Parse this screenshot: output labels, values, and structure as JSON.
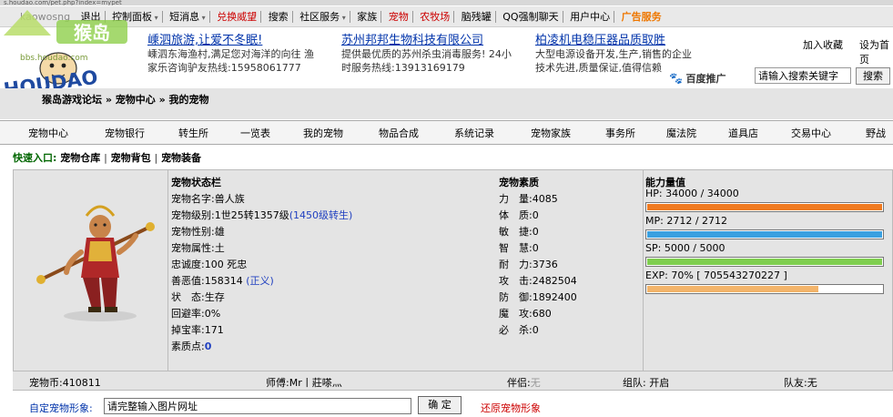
{
  "url_text": "s.houdao.com/pet.php?index=mypet",
  "logo": {
    "overlay": "kaowosng",
    "watermark": "bbs.houdao.com"
  },
  "topnav": [
    {
      "label": "退出",
      "style": ""
    },
    {
      "label": "控制面板",
      "style": "arrow"
    },
    {
      "label": "短消息",
      "style": "arrow"
    },
    {
      "label": "兑换威望",
      "style": "red"
    },
    {
      "label": "搜索",
      "style": ""
    },
    {
      "label": "社区服务",
      "style": "arrow"
    },
    {
      "label": "家族",
      "style": ""
    },
    {
      "label": "宠物",
      "style": "red"
    },
    {
      "label": "农牧场",
      "style": "red"
    },
    {
      "label": "脑残罐",
      "style": ""
    },
    {
      "label": "QQ强制聊天",
      "style": ""
    },
    {
      "label": "用户中心",
      "style": ""
    },
    {
      "label": "广告服务",
      "style": "orange"
    }
  ],
  "ads": [
    {
      "title": "嵊泗旅游,让爱不冬眠!",
      "desc1": "嵊泗东海渔村,满足您对海洋的向往 渔",
      "desc2": "家乐咨询驴友热线:15958061777"
    },
    {
      "title": "苏州邦邦生物科技有限公司",
      "desc1": "提供最优质的苏州杀虫消毒服务! 24小",
      "desc2": "时服务热线:13913169179"
    },
    {
      "title": "柏凌机电稳压器品质取胜",
      "desc1": "大型电源设备开发,生产,销售的企业",
      "desc2": "技术先进,质量保证,值得信赖"
    }
  ],
  "baidu_promo": "百度推广",
  "links": {
    "favorite": "加入收藏",
    "homepage": "设为首页"
  },
  "search": {
    "placeholder": "请输入搜索关键字",
    "button": "搜索"
  },
  "breadcrumb": "猴岛游戏论坛 » 宠物中心 » 我的宠物",
  "menu": [
    "宠物中心",
    "宠物银行",
    "转生所",
    "一览表",
    "我的宠物",
    "物品合成",
    "系统记录",
    "宠物家族",
    "事务所",
    "魔法院",
    "道具店",
    "交易中心",
    "野战"
  ],
  "quick": {
    "label": "快速入口:",
    "links": [
      "宠物仓库",
      "宠物背包",
      "宠物装备"
    ]
  },
  "status": {
    "title": "宠物状态栏",
    "name_label": "宠物名字:",
    "name": "兽人族",
    "level_label": "宠物级别:",
    "level": "1世25转1357级",
    "level_extra": "(1450级转生)",
    "gender_label": "宠物性别:",
    "gender": "雄",
    "attr_label": "宠物属性:",
    "attr": "土",
    "loyalty_label": "忠诚度:",
    "loyalty": "100 死忠",
    "karma_label": "善恶值:",
    "karma": "158314",
    "karma_extra": "(正义)",
    "state_label": "状　态:",
    "state": "生存",
    "dodge_label": "回避率:",
    "dodge": "0%",
    "drop_label": "掉宝率:",
    "drop": "171",
    "points_label": "素质点:",
    "points": "0"
  },
  "quality": {
    "title": "宠物素质",
    "items": [
      {
        "label": "力　量:",
        "value": "4085"
      },
      {
        "label": "体　质:",
        "value": "0"
      },
      {
        "label": "敏　捷:",
        "value": "0"
      },
      {
        "label": "智　慧:",
        "value": "0"
      },
      {
        "label": "耐　力:",
        "value": "3736"
      },
      {
        "label": "攻　击:",
        "value": "2482504"
      },
      {
        "label": "防　御:",
        "value": "1892400"
      },
      {
        "label": "魔　攻:",
        "value": "680"
      },
      {
        "label": "必　杀:",
        "value": "0"
      }
    ]
  },
  "ability": {
    "title": "能力量值",
    "bars": [
      {
        "text": "HP:  34000 / 34000",
        "fill": 1.0,
        "color": "#f07a20"
      },
      {
        "text": "MP:  2712 / 2712",
        "fill": 1.0,
        "color": "#3aa0e0"
      },
      {
        "text": "SP:  5000 / 5000",
        "fill": 1.0,
        "color": "#7fce4f"
      },
      {
        "text": "EXP:  70% [ 705543270227 ]",
        "fill": 0.73,
        "color": "#f3b46a"
      }
    ]
  },
  "footer": {
    "coins_label": "宠物币:",
    "coins": "410811",
    "master_label": "师傅:",
    "master": "Mr丨莊嗏灬",
    "partner_label": "伴侣:",
    "partner": "无",
    "team_label": "组队:",
    "team": "开启",
    "teammate_label": "队友:",
    "teammate": "无"
  },
  "custom": {
    "label": "自定宠物形象:",
    "input_value": "请完整输入图片网址",
    "confirm": "确 定",
    "restore": "还原宠物形象"
  }
}
